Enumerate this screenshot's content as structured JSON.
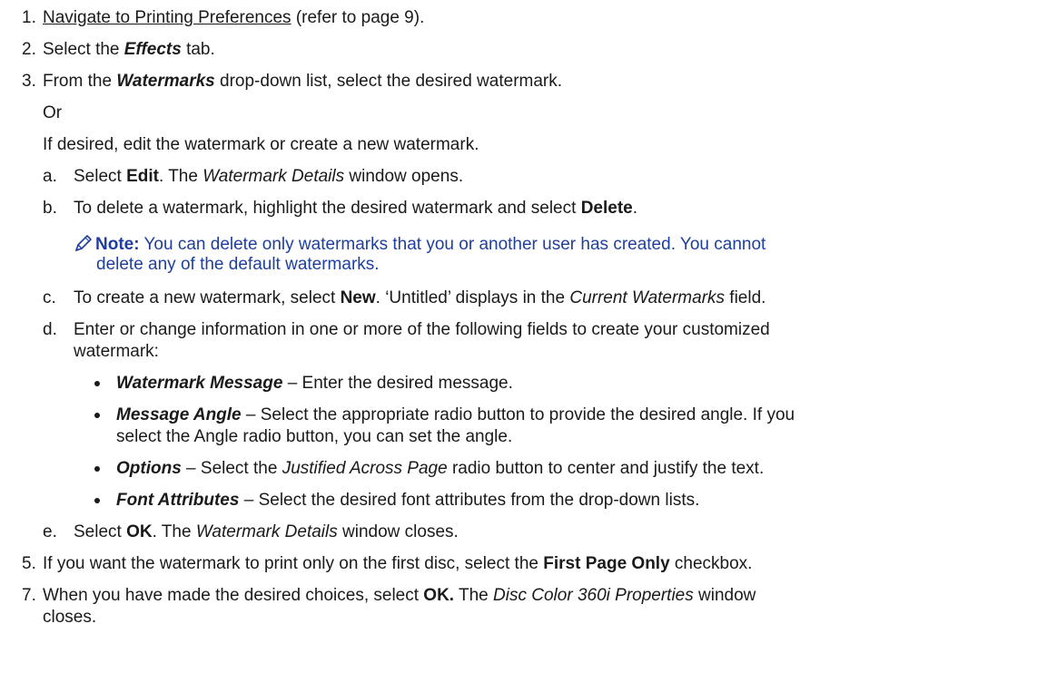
{
  "steps": {
    "s1": {
      "num": "1.",
      "link": "Navigate to Printing Preferences",
      "rest": " (refer to page 9)."
    },
    "s2": {
      "num": "2.",
      "pre": "Select the ",
      "em": "Effects",
      "post": " tab."
    },
    "s3": {
      "num": "3.",
      "pre": "From the ",
      "em": "Watermarks",
      "post": " drop-down list, select the desired watermark."
    },
    "or": "Or",
    "ifdesired": "If desired, edit the watermark or create a new watermark.",
    "a": {
      "num": "a.",
      "pre": "Select ",
      "b": "Edit",
      "mid": ". The ",
      "i": "Watermark Details",
      "post": " window opens."
    },
    "b": {
      "num": "b.",
      "pre": "To delete a watermark, highlight the desired watermark and select ",
      "b": "Delete",
      "post": "."
    },
    "note": {
      "label": "Note:",
      "line1": " You can delete only watermarks that you or another user has created. You cannot",
      "line2": "delete any of the default watermarks."
    },
    "c": {
      "num": "c.",
      "pre": "To create a new watermark, select ",
      "b": "New",
      "mid": ". ‘Untitled’ displays in the ",
      "i": "Current Watermarks",
      "post": " field."
    },
    "d": {
      "num": "d.",
      "line1": "Enter or change information in one or more of the following fields to create your customized",
      "line2": "watermark:"
    },
    "bullets": [
      {
        "term": "Watermark Message",
        "text": " – Enter the desired message."
      },
      {
        "term": "Message Angle",
        "text": " – Select the appropriate radio button to provide the desired angle. If you",
        "line2": "select the Angle radio button, you can set the angle."
      },
      {
        "term": "Options",
        "pre": " – Select the ",
        "i": "Justified Across Page",
        "post": " radio button to center and justify the text."
      },
      {
        "term": "Font Attributes",
        "text": " – Select the desired font attributes from the drop-down lists."
      }
    ],
    "e": {
      "num": "e.",
      "pre": "Select ",
      "b": "OK",
      "mid": ". The ",
      "i": "Watermark Details",
      "post": " window closes."
    },
    "s5": {
      "num": "5.",
      "pre": "If you want the watermark to print only on the first disc, select the ",
      "b": "First Page Only",
      "post": " checkbox."
    },
    "s7": {
      "num": "7.",
      "pre": "When you have made the desired choices, select ",
      "b": "OK.",
      "mid": " The ",
      "i": "Disc Color 360i Properties",
      "post": " window",
      "line2": "closes."
    }
  },
  "colors": {
    "text": "#1a1a1a",
    "note": "#1f3f9f"
  },
  "icons": {
    "note": "pencil-note-icon"
  }
}
